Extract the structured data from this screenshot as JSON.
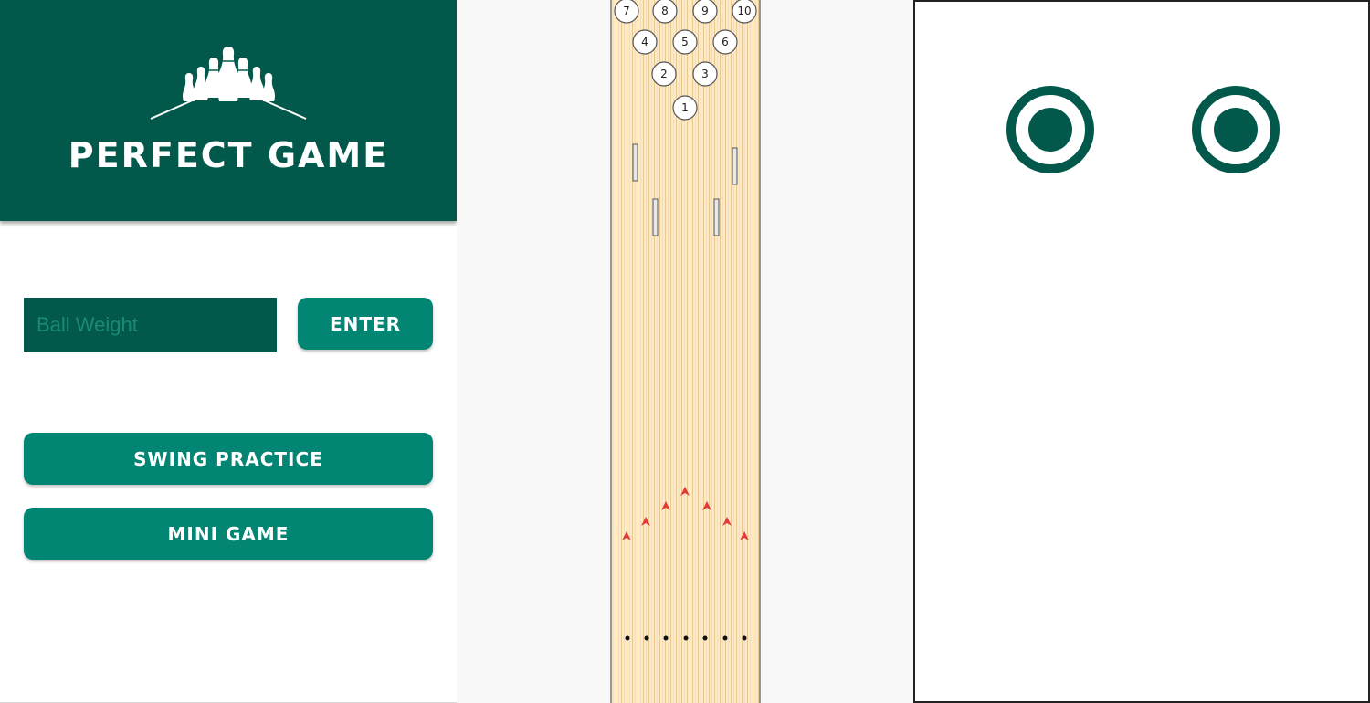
{
  "home": {
    "title": "PERFECT GAME",
    "ball_weight_placeholder": "Ball Weight",
    "enter_label": "ENTER",
    "swing_practice_label": "SWING PRACTICE",
    "mini_game_label": "MINI GAME"
  },
  "lane": {
    "pins": [
      "1",
      "2",
      "3",
      "4",
      "5",
      "6",
      "7",
      "8",
      "9",
      "10"
    ]
  },
  "colors": {
    "header_green": "#02594b",
    "button_teal": "#028572",
    "lane_wood": "#f8e2b8",
    "arrow_red": "#e53935"
  }
}
